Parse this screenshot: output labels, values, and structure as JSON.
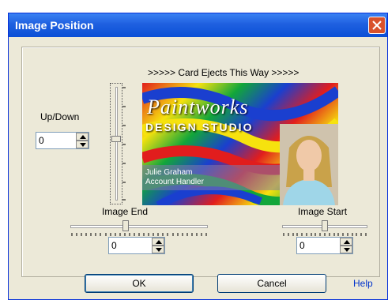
{
  "window": {
    "title": "Image Position",
    "close_icon": "close-icon"
  },
  "direction_text": ">>>>> Card Ejects This Way >>>>>",
  "updown": {
    "label": "Up/Down",
    "value": "0"
  },
  "image_end": {
    "label": "Image End",
    "value": "0",
    "position": 0.4
  },
  "image_start": {
    "label": "Image Start",
    "value": "0",
    "position": 0.5
  },
  "card": {
    "brand": "Paintworks",
    "subtitle": "DESIGN STUDIO",
    "person_name": "Julie Graham",
    "person_title": "Account Handler"
  },
  "buttons": {
    "ok": "OK",
    "cancel": "Cancel",
    "help": "Help"
  },
  "colors": {
    "titlebar": "#0a4fd6",
    "dialog_bg": "#ece9d8",
    "link": "#0033cc"
  }
}
